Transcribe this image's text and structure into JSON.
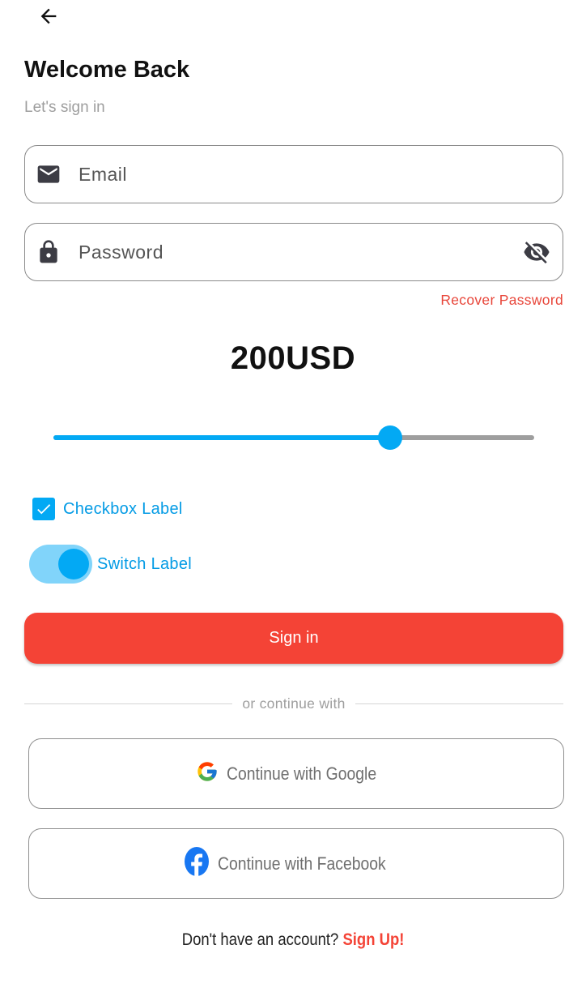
{
  "header": {
    "back_icon": "arrow-left-icon",
    "title": "Welcome Back",
    "subtitle": "Let's sign in"
  },
  "form": {
    "email": {
      "placeholder": "Email",
      "value": "",
      "icon": "mail-icon"
    },
    "password": {
      "placeholder": "Password",
      "value": "",
      "icon": "lock-icon",
      "toggle_icon": "eye-off-icon"
    },
    "recover_label": "Recover Password"
  },
  "amount": {
    "label": "200USD",
    "slider_fraction": 0.7
  },
  "checkbox": {
    "label": "Checkbox Label",
    "checked": true
  },
  "switch": {
    "label": "Switch Label",
    "on": true
  },
  "signin_label": "Sign in",
  "divider_text": "or continue with",
  "social": {
    "google_label": "Continue with Google",
    "facebook_label": "Continue with Facebook"
  },
  "footer": {
    "prompt": "Don't have an account? ",
    "signup_label": "Sign Up!"
  },
  "colors": {
    "accent": "#03a9f4",
    "primary_button": "#f44336",
    "link_red": "#e8463a"
  }
}
